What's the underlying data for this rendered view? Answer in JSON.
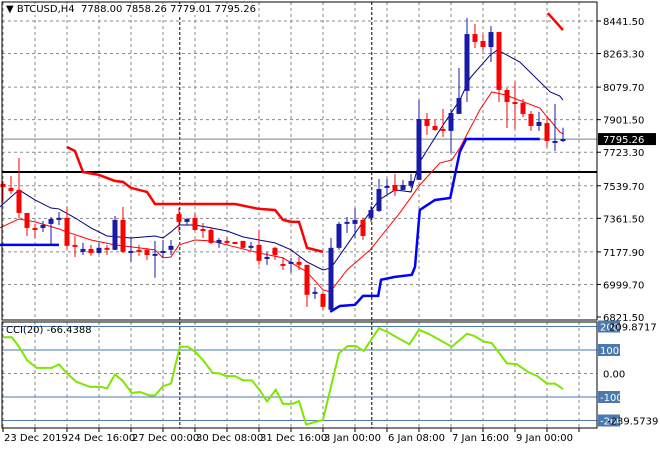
{
  "header": {
    "symbol": "BTCUSD,H4",
    "ohlc": "7788.00 7858.26 7779.01 7795.26",
    "icon": "triangle-down-icon"
  },
  "cci_header": {
    "label": "CCI(20) -66.4388"
  },
  "colors": {
    "bull": "#1a1aa8",
    "bear": "#ff0000",
    "grid": "#8a8a8a",
    "cci": "#7fe600",
    "level": "#4a7ab0",
    "price_box": "#000000"
  },
  "chart_data": {
    "type": "candlestick",
    "symbol": "BTCUSD",
    "timeframe": "H4",
    "current_price": 7795.26,
    "current_price_label": "7795.26",
    "y_ticks": [
      "8441.50",
      "8263.30",
      "8079.70",
      "7901.50",
      "7723.30",
      "7539.70",
      "7361.50",
      "7177.90",
      "6999.70",
      "6821.50"
    ],
    "y_tick_values": [
      8441.5,
      8263.3,
      8079.7,
      7901.5,
      7723.3,
      7539.7,
      7361.5,
      7177.9,
      6999.7,
      6821.5
    ],
    "x_labels": [
      {
        "bar": 0,
        "label": "23 Dec 2019"
      },
      {
        "bar": 8,
        "label": "24 Dec 16:00"
      },
      {
        "bar": 16,
        "label": "27 Dec 00:00"
      },
      {
        "bar": 24,
        "label": "30 Dec 08:00"
      },
      {
        "bar": 32,
        "label": "31 Dec 16:00"
      },
      {
        "bar": 40,
        "label": "3 Jan 00:00"
      },
      {
        "bar": 48,
        "label": "6 Jan 08:00"
      },
      {
        "bar": 56,
        "label": "7 Jan 16:00"
      },
      {
        "bar": 64,
        "label": "9 Jan 00:00"
      }
    ],
    "week_separators": [
      22.1,
      46.1
    ],
    "candles_ohlc": [
      [
        7550,
        7566,
        7457,
        7533
      ],
      [
        7528,
        7593,
        7495,
        7511
      ],
      [
        7517,
        7692,
        7364,
        7391
      ],
      [
        7391,
        7391,
        7265,
        7309
      ],
      [
        7309,
        7331,
        7254,
        7303
      ],
      [
        7309,
        7347,
        7287,
        7325
      ],
      [
        7331,
        7369,
        7216,
        7358
      ],
      [
        7358,
        7396,
        7325,
        7364
      ],
      [
        7364,
        7424,
        7194,
        7211
      ],
      [
        7216,
        7265,
        7150,
        7205
      ],
      [
        7178,
        7227,
        7161,
        7194
      ],
      [
        7194,
        7216,
        7156,
        7172
      ],
      [
        7172,
        7227,
        7167,
        7200
      ],
      [
        7200,
        7216,
        7161,
        7189
      ],
      [
        7189,
        7374,
        7189,
        7353
      ],
      [
        7353,
        7424,
        7172,
        7178
      ],
      [
        7172,
        7254,
        7123,
        7183
      ],
      [
        7189,
        7216,
        7156,
        7178
      ],
      [
        7189,
        7200,
        7134,
        7161
      ],
      [
        7161,
        7238,
        7036,
        7167
      ],
      [
        7172,
        7243,
        7145,
        7183
      ],
      [
        7189,
        7243,
        7161,
        7211
      ],
      [
        7385,
        7418,
        7287,
        7342
      ],
      [
        7342,
        7364,
        7325,
        7358
      ],
      [
        7364,
        7391,
        7292,
        7298
      ],
      [
        7303,
        7336,
        7254,
        7298
      ],
      [
        7298,
        7314,
        7221,
        7227
      ],
      [
        7227,
        7254,
        7200,
        7243
      ],
      [
        7238,
        7260,
        7221,
        7232
      ],
      [
        7232,
        7232,
        7221,
        7227
      ],
      [
        7238,
        7238,
        7194,
        7200
      ],
      [
        7200,
        7232,
        7189,
        7211
      ],
      [
        7216,
        7298,
        7107,
        7129
      ],
      [
        7145,
        7178,
        7107,
        7150
      ],
      [
        7200,
        7205,
        7134,
        7161
      ],
      [
        7112,
        7150,
        7079,
        7107
      ],
      [
        7112,
        7145,
        7063,
        7123
      ],
      [
        7123,
        7150,
        7079,
        7107
      ],
      [
        7107,
        7107,
        6877,
        6943
      ],
      [
        6948,
        6986,
        6921,
        6959
      ],
      [
        6948,
        6953,
        6861,
        6877
      ],
      [
        6861,
        7254,
        6855,
        7200
      ],
      [
        7200,
        7342,
        7189,
        7331
      ],
      [
        7331,
        7369,
        7282,
        7342
      ],
      [
        7331,
        7417,
        7254,
        7353
      ],
      [
        7353,
        7364,
        7243,
        7265
      ],
      [
        7364,
        7429,
        7342,
        7407
      ],
      [
        7402,
        7577,
        7396,
        7522
      ],
      [
        7528,
        7577,
        7495,
        7539
      ],
      [
        7544,
        7604,
        7484,
        7511
      ],
      [
        7517,
        7572,
        7517,
        7544
      ],
      [
        7539,
        7604,
        7528,
        7566
      ],
      [
        7572,
        8009,
        7572,
        7905
      ],
      [
        7905,
        7938,
        7818,
        7867
      ],
      [
        7867,
        7900,
        7840,
        7845
      ],
      [
        7851,
        7960,
        7807,
        7840
      ],
      [
        7840,
        7960,
        7719,
        7938
      ],
      [
        7933,
        8184,
        7933,
        8020
      ],
      [
        8059,
        8458,
        7998,
        8370
      ],
      [
        8370,
        8425,
        8294,
        8327
      ],
      [
        8332,
        8370,
        8283,
        8299
      ],
      [
        8299,
        8414,
        8217,
        8381
      ],
      [
        8381,
        8381,
        7998,
        8064
      ],
      [
        8064,
        8075,
        7856,
        7998
      ],
      [
        7998,
        8108,
        7851,
        7993
      ],
      [
        7993,
        8015,
        7916,
        7933
      ],
      [
        7933,
        7949,
        7840,
        7867
      ],
      [
        7867,
        7944,
        7840,
        7889
      ],
      [
        7883,
        7922,
        7752,
        7785
      ],
      [
        7785,
        7987,
        7730,
        7785
      ],
      [
        7788,
        7858.26,
        7779.01,
        7795.26
      ]
    ],
    "horizontal_level": 7615,
    "indicators": [
      {
        "name": "ma-slow",
        "color": "#000080",
        "width": 1,
        "points": [
          [
            -0.4,
            7424
          ],
          [
            2,
            7517
          ],
          [
            4,
            7462
          ],
          [
            6,
            7418
          ],
          [
            7,
            7413
          ],
          [
            9,
            7364
          ],
          [
            11,
            7309
          ],
          [
            13,
            7265
          ],
          [
            16,
            7254
          ],
          [
            19,
            7265
          ],
          [
            20,
            7254
          ],
          [
            21,
            7287
          ],
          [
            22,
            7325
          ],
          [
            24,
            7325
          ],
          [
            26,
            7309
          ],
          [
            28,
            7292
          ],
          [
            30,
            7260
          ],
          [
            32,
            7243
          ],
          [
            34,
            7227
          ],
          [
            36,
            7189
          ],
          [
            38,
            7123
          ],
          [
            40,
            7079
          ],
          [
            41,
            7090
          ],
          [
            43,
            7216
          ],
          [
            45,
            7342
          ],
          [
            47,
            7462
          ],
          [
            49,
            7517
          ],
          [
            51,
            7506
          ],
          [
            52,
            7664
          ],
          [
            54.6,
            7845
          ],
          [
            57.1,
            8009
          ],
          [
            58.4,
            8130
          ],
          [
            60.9,
            8255
          ],
          [
            61.8,
            8283
          ],
          [
            64.6,
            8217
          ],
          [
            68.4,
            8053
          ],
          [
            69.6,
            8031
          ],
          [
            70,
            8009
          ]
        ]
      },
      {
        "name": "ma-fast",
        "color": "#ff0000",
        "width": 1,
        "points": [
          [
            -0.4,
            7309
          ],
          [
            2,
            7358
          ],
          [
            4,
            7342
          ],
          [
            7,
            7303
          ],
          [
            8,
            7287
          ],
          [
            11,
            7243
          ],
          [
            14,
            7216
          ],
          [
            19,
            7189
          ],
          [
            20,
            7145
          ],
          [
            21,
            7150
          ],
          [
            22,
            7216
          ],
          [
            24,
            7243
          ],
          [
            26,
            7238
          ],
          [
            29,
            7205
          ],
          [
            32,
            7172
          ],
          [
            35,
            7145
          ],
          [
            38,
            7068
          ],
          [
            40,
            6970
          ],
          [
            40.9,
            6959
          ],
          [
            43,
            7079
          ],
          [
            45.9,
            7189
          ],
          [
            49.6,
            7391
          ],
          [
            52.1,
            7544
          ],
          [
            54.6,
            7664
          ],
          [
            56.1,
            7681
          ],
          [
            57.1,
            7746
          ],
          [
            59.6,
            7955
          ],
          [
            61.1,
            8053
          ],
          [
            62.8,
            8037
          ],
          [
            67.1,
            7965
          ],
          [
            69.6,
            7834
          ],
          [
            70,
            7823
          ]
        ]
      },
      {
        "name": "stop-upper-1",
        "color": "#ff0000",
        "width": 2.5,
        "points": [
          [
            8,
            7752
          ],
          [
            9,
            7730
          ],
          [
            10,
            7615
          ],
          [
            12,
            7599
          ],
          [
            14,
            7566
          ],
          [
            15,
            7561
          ],
          [
            16,
            7528
          ],
          [
            18,
            7506
          ],
          [
            19,
            7440
          ],
          [
            29,
            7440
          ],
          [
            32,
            7413
          ],
          [
            34,
            7407
          ],
          [
            35,
            7353
          ],
          [
            36,
            7342
          ],
          [
            37,
            7342
          ],
          [
            38,
            7200
          ],
          [
            40,
            7178
          ]
        ]
      },
      {
        "name": "stop-upper-2",
        "color": "#ff0000",
        "width": 2.5,
        "points": [
          [
            68.1,
            8485
          ],
          [
            70,
            8392
          ]
        ]
      },
      {
        "name": "stop-lower-1",
        "color": "#0000ff",
        "width": 2.5,
        "points": [
          [
            -0.4,
            7216
          ],
          [
            7,
            7216
          ]
        ]
      },
      {
        "name": "stop-lower-2",
        "color": "#0000ff",
        "width": 2.5,
        "points": [
          [
            40.9,
            6850
          ],
          [
            42.1,
            6882
          ],
          [
            44,
            6888
          ],
          [
            45,
            6937
          ],
          [
            46.9,
            6937
          ],
          [
            47.25,
            7025
          ],
          [
            49,
            7041
          ],
          [
            51.1,
            7052
          ],
          [
            51.5,
            7096
          ],
          [
            52.1,
            7407
          ],
          [
            54,
            7462
          ],
          [
            55.9,
            7473
          ],
          [
            56.5,
            7599
          ],
          [
            57.1,
            7725
          ],
          [
            57.9,
            7796
          ],
          [
            67.1,
            7796
          ]
        ]
      }
    ],
    "cci": {
      "period": 20,
      "last_value": -66.4388,
      "axis_max_label": "209.8717",
      "axis_min_label": "-239.5739",
      "levels": [
        200,
        100,
        -100,
        -200
      ],
      "level_labels": [
        "200",
        "100",
        "-100",
        "-200"
      ],
      "zero_label": "0.00",
      "points": [
        [
          0,
          154
        ],
        [
          1.1,
          154
        ],
        [
          2,
          114
        ],
        [
          3,
          57
        ],
        [
          4.2,
          24
        ],
        [
          6.1,
          24
        ],
        [
          7,
          39
        ],
        [
          8,
          0
        ],
        [
          9.2,
          -36
        ],
        [
          10.9,
          -57
        ],
        [
          12.3,
          -57
        ],
        [
          13,
          -64
        ],
        [
          14,
          -4
        ],
        [
          14.9,
          -29
        ],
        [
          16.1,
          -83
        ],
        [
          17.1,
          -79
        ],
        [
          18.3,
          -93
        ],
        [
          19,
          -93
        ],
        [
          20,
          -54
        ],
        [
          21,
          -43
        ],
        [
          22.1,
          114
        ],
        [
          23.1,
          114
        ],
        [
          24,
          93
        ],
        [
          25,
          57
        ],
        [
          26.2,
          3
        ],
        [
          27.1,
          0
        ],
        [
          27.9,
          -11
        ],
        [
          29,
          -11
        ],
        [
          30,
          -29
        ],
        [
          31.1,
          -29
        ],
        [
          32.1,
          -71
        ],
        [
          33,
          -119
        ],
        [
          34.1,
          -69
        ],
        [
          35,
          -129
        ],
        [
          36.2,
          -129
        ],
        [
          37,
          -117
        ],
        [
          37.9,
          -217
        ],
        [
          40,
          -197
        ],
        [
          42,
          86
        ],
        [
          43.1,
          117
        ],
        [
          44.1,
          117
        ],
        [
          45.1,
          96
        ],
        [
          46,
          143
        ],
        [
          47,
          193
        ],
        [
          47.9,
          179
        ],
        [
          50.8,
          124
        ],
        [
          52,
          186
        ],
        [
          53.2,
          169
        ],
        [
          56.1,
          114
        ],
        [
          58,
          169
        ],
        [
          58.9,
          160
        ],
        [
          60.1,
          136
        ],
        [
          61.1,
          129
        ],
        [
          63,
          43
        ],
        [
          64.2,
          40
        ],
        [
          65.6,
          7
        ],
        [
          66.8,
          -11
        ],
        [
          68,
          -43
        ],
        [
          69,
          -43
        ],
        [
          70,
          -66.44
        ]
      ]
    }
  }
}
